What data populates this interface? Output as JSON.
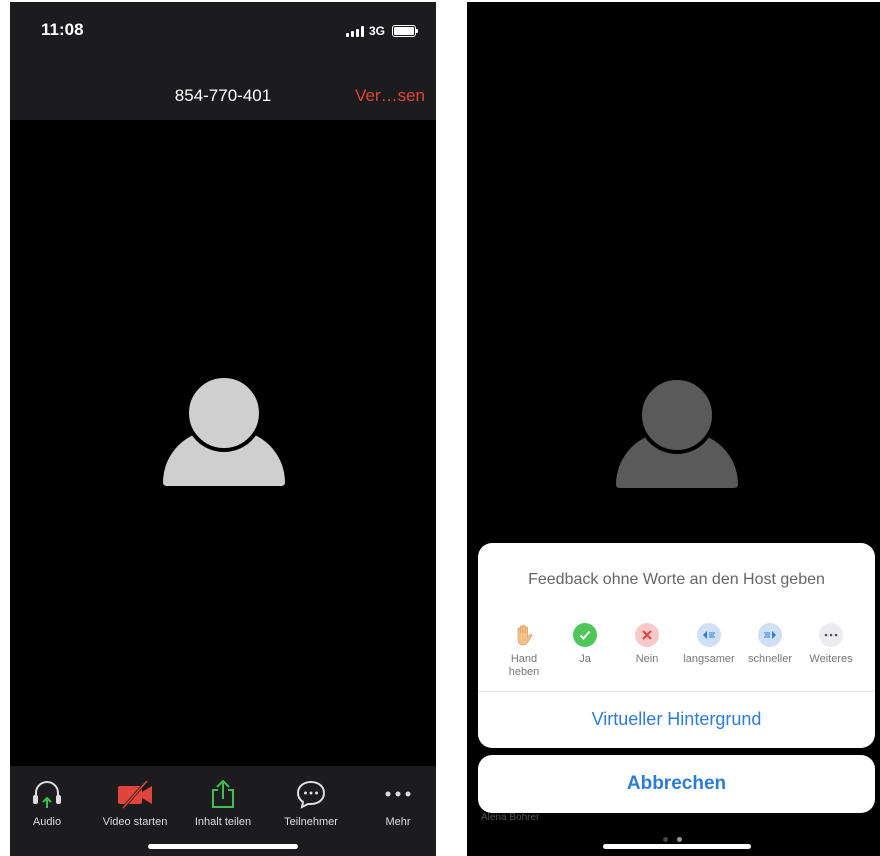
{
  "left": {
    "status": {
      "time": "11:08",
      "network": "3G"
    },
    "header": {
      "meeting_id": "854-770-401",
      "leave_label": "Ver…sen"
    },
    "toolbar": [
      {
        "label": "Audio",
        "icon": "headphones-icon"
      },
      {
        "label": "Video starten",
        "icon": "video-off-icon"
      },
      {
        "label": "Inhalt teilen",
        "icon": "share-icon"
      },
      {
        "label": "Teilnehmer",
        "icon": "chat-bubble-icon"
      },
      {
        "label": "Mehr",
        "icon": "more-dots-icon"
      }
    ]
  },
  "right": {
    "sheet": {
      "title": "Feedback ohne Worte an den Host geben",
      "feedback": [
        {
          "label": "Hand heben",
          "icon": "raise-hand-icon"
        },
        {
          "label": "Ja",
          "icon": "check-icon"
        },
        {
          "label": "Nein",
          "icon": "cross-icon"
        },
        {
          "label": "langsamer",
          "icon": "slower-icon"
        },
        {
          "label": "schneller",
          "icon": "faster-icon"
        },
        {
          "label": "Weiteres",
          "icon": "more-icon"
        }
      ],
      "virtual_background": "Virtueller Hintergrund"
    },
    "cancel_label": "Abbrechen",
    "participant_name": "Alena Bohrer"
  },
  "colors": {
    "accent_red": "#e0443a",
    "accent_blue": "#2d7cd6",
    "share_green": "#3fbf4f"
  }
}
